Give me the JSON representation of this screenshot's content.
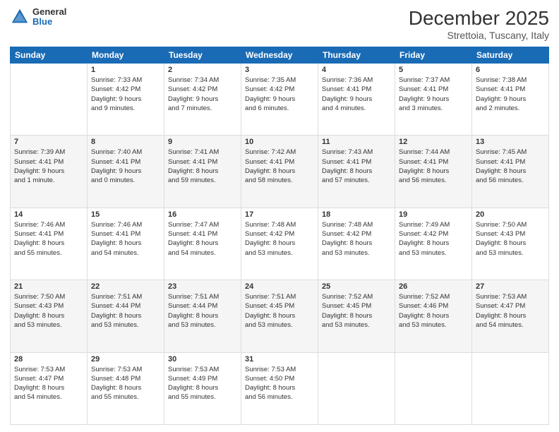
{
  "header": {
    "logo_general": "General",
    "logo_blue": "Blue",
    "month": "December 2025",
    "location": "Strettoia, Tuscany, Italy"
  },
  "days_of_week": [
    "Sunday",
    "Monday",
    "Tuesday",
    "Wednesday",
    "Thursday",
    "Friday",
    "Saturday"
  ],
  "weeks": [
    [
      {
        "day": "",
        "sunrise": "",
        "sunset": "",
        "daylight": ""
      },
      {
        "day": "1",
        "sunrise": "Sunrise: 7:33 AM",
        "sunset": "Sunset: 4:42 PM",
        "daylight": "Daylight: 9 hours and 9 minutes."
      },
      {
        "day": "2",
        "sunrise": "Sunrise: 7:34 AM",
        "sunset": "Sunset: 4:42 PM",
        "daylight": "Daylight: 9 hours and 7 minutes."
      },
      {
        "day": "3",
        "sunrise": "Sunrise: 7:35 AM",
        "sunset": "Sunset: 4:42 PM",
        "daylight": "Daylight: 9 hours and 6 minutes."
      },
      {
        "day": "4",
        "sunrise": "Sunrise: 7:36 AM",
        "sunset": "Sunset: 4:41 PM",
        "daylight": "Daylight: 9 hours and 4 minutes."
      },
      {
        "day": "5",
        "sunrise": "Sunrise: 7:37 AM",
        "sunset": "Sunset: 4:41 PM",
        "daylight": "Daylight: 9 hours and 3 minutes."
      },
      {
        "day": "6",
        "sunrise": "Sunrise: 7:38 AM",
        "sunset": "Sunset: 4:41 PM",
        "daylight": "Daylight: 9 hours and 2 minutes."
      }
    ],
    [
      {
        "day": "7",
        "sunrise": "Sunrise: 7:39 AM",
        "sunset": "Sunset: 4:41 PM",
        "daylight": "Daylight: 9 hours and 1 minute."
      },
      {
        "day": "8",
        "sunrise": "Sunrise: 7:40 AM",
        "sunset": "Sunset: 4:41 PM",
        "daylight": "Daylight: 9 hours and 0 minutes."
      },
      {
        "day": "9",
        "sunrise": "Sunrise: 7:41 AM",
        "sunset": "Sunset: 4:41 PM",
        "daylight": "Daylight: 8 hours and 59 minutes."
      },
      {
        "day": "10",
        "sunrise": "Sunrise: 7:42 AM",
        "sunset": "Sunset: 4:41 PM",
        "daylight": "Daylight: 8 hours and 58 minutes."
      },
      {
        "day": "11",
        "sunrise": "Sunrise: 7:43 AM",
        "sunset": "Sunset: 4:41 PM",
        "daylight": "Daylight: 8 hours and 57 minutes."
      },
      {
        "day": "12",
        "sunrise": "Sunrise: 7:44 AM",
        "sunset": "Sunset: 4:41 PM",
        "daylight": "Daylight: 8 hours and 56 minutes."
      },
      {
        "day": "13",
        "sunrise": "Sunrise: 7:45 AM",
        "sunset": "Sunset: 4:41 PM",
        "daylight": "Daylight: 8 hours and 56 minutes."
      }
    ],
    [
      {
        "day": "14",
        "sunrise": "Sunrise: 7:46 AM",
        "sunset": "Sunset: 4:41 PM",
        "daylight": "Daylight: 8 hours and 55 minutes."
      },
      {
        "day": "15",
        "sunrise": "Sunrise: 7:46 AM",
        "sunset": "Sunset: 4:41 PM",
        "daylight": "Daylight: 8 hours and 54 minutes."
      },
      {
        "day": "16",
        "sunrise": "Sunrise: 7:47 AM",
        "sunset": "Sunset: 4:41 PM",
        "daylight": "Daylight: 8 hours and 54 minutes."
      },
      {
        "day": "17",
        "sunrise": "Sunrise: 7:48 AM",
        "sunset": "Sunset: 4:42 PM",
        "daylight": "Daylight: 8 hours and 53 minutes."
      },
      {
        "day": "18",
        "sunrise": "Sunrise: 7:48 AM",
        "sunset": "Sunset: 4:42 PM",
        "daylight": "Daylight: 8 hours and 53 minutes."
      },
      {
        "day": "19",
        "sunrise": "Sunrise: 7:49 AM",
        "sunset": "Sunset: 4:42 PM",
        "daylight": "Daylight: 8 hours and 53 minutes."
      },
      {
        "day": "20",
        "sunrise": "Sunrise: 7:50 AM",
        "sunset": "Sunset: 4:43 PM",
        "daylight": "Daylight: 8 hours and 53 minutes."
      }
    ],
    [
      {
        "day": "21",
        "sunrise": "Sunrise: 7:50 AM",
        "sunset": "Sunset: 4:43 PM",
        "daylight": "Daylight: 8 hours and 53 minutes."
      },
      {
        "day": "22",
        "sunrise": "Sunrise: 7:51 AM",
        "sunset": "Sunset: 4:44 PM",
        "daylight": "Daylight: 8 hours and 53 minutes."
      },
      {
        "day": "23",
        "sunrise": "Sunrise: 7:51 AM",
        "sunset": "Sunset: 4:44 PM",
        "daylight": "Daylight: 8 hours and 53 minutes."
      },
      {
        "day": "24",
        "sunrise": "Sunrise: 7:51 AM",
        "sunset": "Sunset: 4:45 PM",
        "daylight": "Daylight: 8 hours and 53 minutes."
      },
      {
        "day": "25",
        "sunrise": "Sunrise: 7:52 AM",
        "sunset": "Sunset: 4:45 PM",
        "daylight": "Daylight: 8 hours and 53 minutes."
      },
      {
        "day": "26",
        "sunrise": "Sunrise: 7:52 AM",
        "sunset": "Sunset: 4:46 PM",
        "daylight": "Daylight: 8 hours and 53 minutes."
      },
      {
        "day": "27",
        "sunrise": "Sunrise: 7:53 AM",
        "sunset": "Sunset: 4:47 PM",
        "daylight": "Daylight: 8 hours and 54 minutes."
      }
    ],
    [
      {
        "day": "28",
        "sunrise": "Sunrise: 7:53 AM",
        "sunset": "Sunset: 4:47 PM",
        "daylight": "Daylight: 8 hours and 54 minutes."
      },
      {
        "day": "29",
        "sunrise": "Sunrise: 7:53 AM",
        "sunset": "Sunset: 4:48 PM",
        "daylight": "Daylight: 8 hours and 55 minutes."
      },
      {
        "day": "30",
        "sunrise": "Sunrise: 7:53 AM",
        "sunset": "Sunset: 4:49 PM",
        "daylight": "Daylight: 8 hours and 55 minutes."
      },
      {
        "day": "31",
        "sunrise": "Sunrise: 7:53 AM",
        "sunset": "Sunset: 4:50 PM",
        "daylight": "Daylight: 8 hours and 56 minutes."
      },
      {
        "day": "",
        "sunrise": "",
        "sunset": "",
        "daylight": ""
      },
      {
        "day": "",
        "sunrise": "",
        "sunset": "",
        "daylight": ""
      },
      {
        "day": "",
        "sunrise": "",
        "sunset": "",
        "daylight": ""
      }
    ]
  ]
}
